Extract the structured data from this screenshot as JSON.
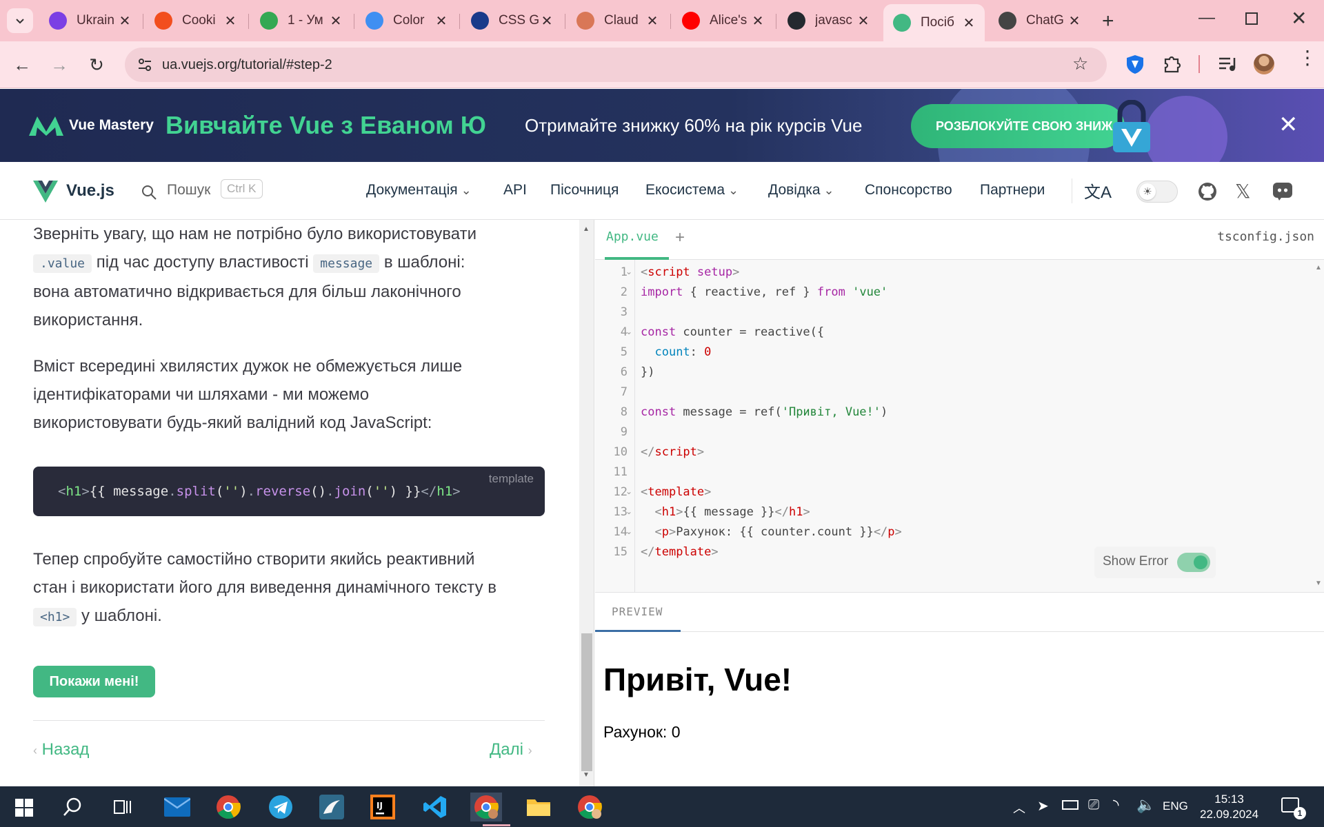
{
  "browser": {
    "tabs": [
      {
        "title": "Ukrain",
        "icon": "ukr-icon",
        "color": "#7b3fe4"
      },
      {
        "title": "Cooki",
        "icon": "figma-icon",
        "color": "#f24e1e"
      },
      {
        "title": "1 - Ум",
        "icon": "drive-icon",
        "color": "#34a853"
      },
      {
        "title": "Color",
        "icon": "canva-icon",
        "color": "#3f8ff2"
      },
      {
        "title": "CSS G",
        "icon": "css-icon",
        "color": "#1a3a8a"
      },
      {
        "title": "Claud",
        "icon": "claude-icon",
        "color": "#d97757"
      },
      {
        "title": "Alice's",
        "icon": "youtube-icon",
        "color": "#ff0000"
      },
      {
        "title": "javasc",
        "icon": "github-icon",
        "color": "#24292f"
      },
      {
        "title": "Посіб",
        "icon": "vue-icon",
        "color": "#42b883",
        "active": true
      },
      {
        "title": "ChatG",
        "icon": "chatgpt-icon",
        "color": "#444444"
      }
    ],
    "url": "ua.vuejs.org/tutorial/#step-2"
  },
  "banner": {
    "brand": "Vue Mastery",
    "headline": "Вивчайте Vue з Еваном Ю",
    "subtext": "Отримайте знижку 60% на рік курсів Vue",
    "cta": "РОЗБЛОКУЙТЕ СВОЮ ЗНИЖ"
  },
  "vuenav": {
    "brand": "Vue.js",
    "search_label": "Пошук",
    "search_kbd": "Ctrl K",
    "links": [
      "Документація",
      "API",
      "Пісочниця",
      "Екосистема",
      "Довідка",
      "Спонсорство",
      "Партнери"
    ]
  },
  "tutorial": {
    "p1a": "Зверніть увагу, що нам не потрібно було використовувати",
    "p1_code1": ".value",
    "p1b": "під час доступу властивості",
    "p1_code2": "message",
    "p1c": "в шаблоні:",
    "p1d": "вона автоматично відкривається для більш лаконічного",
    "p1e": "використання.",
    "p2a": "Вміст всередині хвилястих дужок не обмежується лише",
    "p2b": "ідентифікаторами чи шляхами - ми можемо",
    "p2c": "використовувати будь-який валідний код JavaScript:",
    "code_lang": "template",
    "p3a": "Тепер спробуйте самостійно створити якийсь реактивний",
    "p3b": "стан і використати його для виведення динамічного тексту в",
    "p3_code": "<h1>",
    "p3c": "у шаблоні.",
    "show_button": "Покажи мені!",
    "prev": "Назад",
    "next": "Далі"
  },
  "editor": {
    "tab_file": "App.vue",
    "tab_add": "+",
    "tab_config": "tsconfig.json",
    "line_numbers": [
      "1",
      "2",
      "3",
      "4",
      "5",
      "6",
      "7",
      "8",
      "9",
      "10",
      "11",
      "12",
      "13",
      "14",
      "15"
    ],
    "show_error_label": "Show Error"
  },
  "preview": {
    "label": "PREVIEW",
    "heading": "Привіт, Vue!",
    "counter_text": "Рахунок: 0"
  },
  "taskbar": {
    "lang": "ENG",
    "time": "15:13",
    "date": "22.09.2024",
    "notifications": "1"
  }
}
